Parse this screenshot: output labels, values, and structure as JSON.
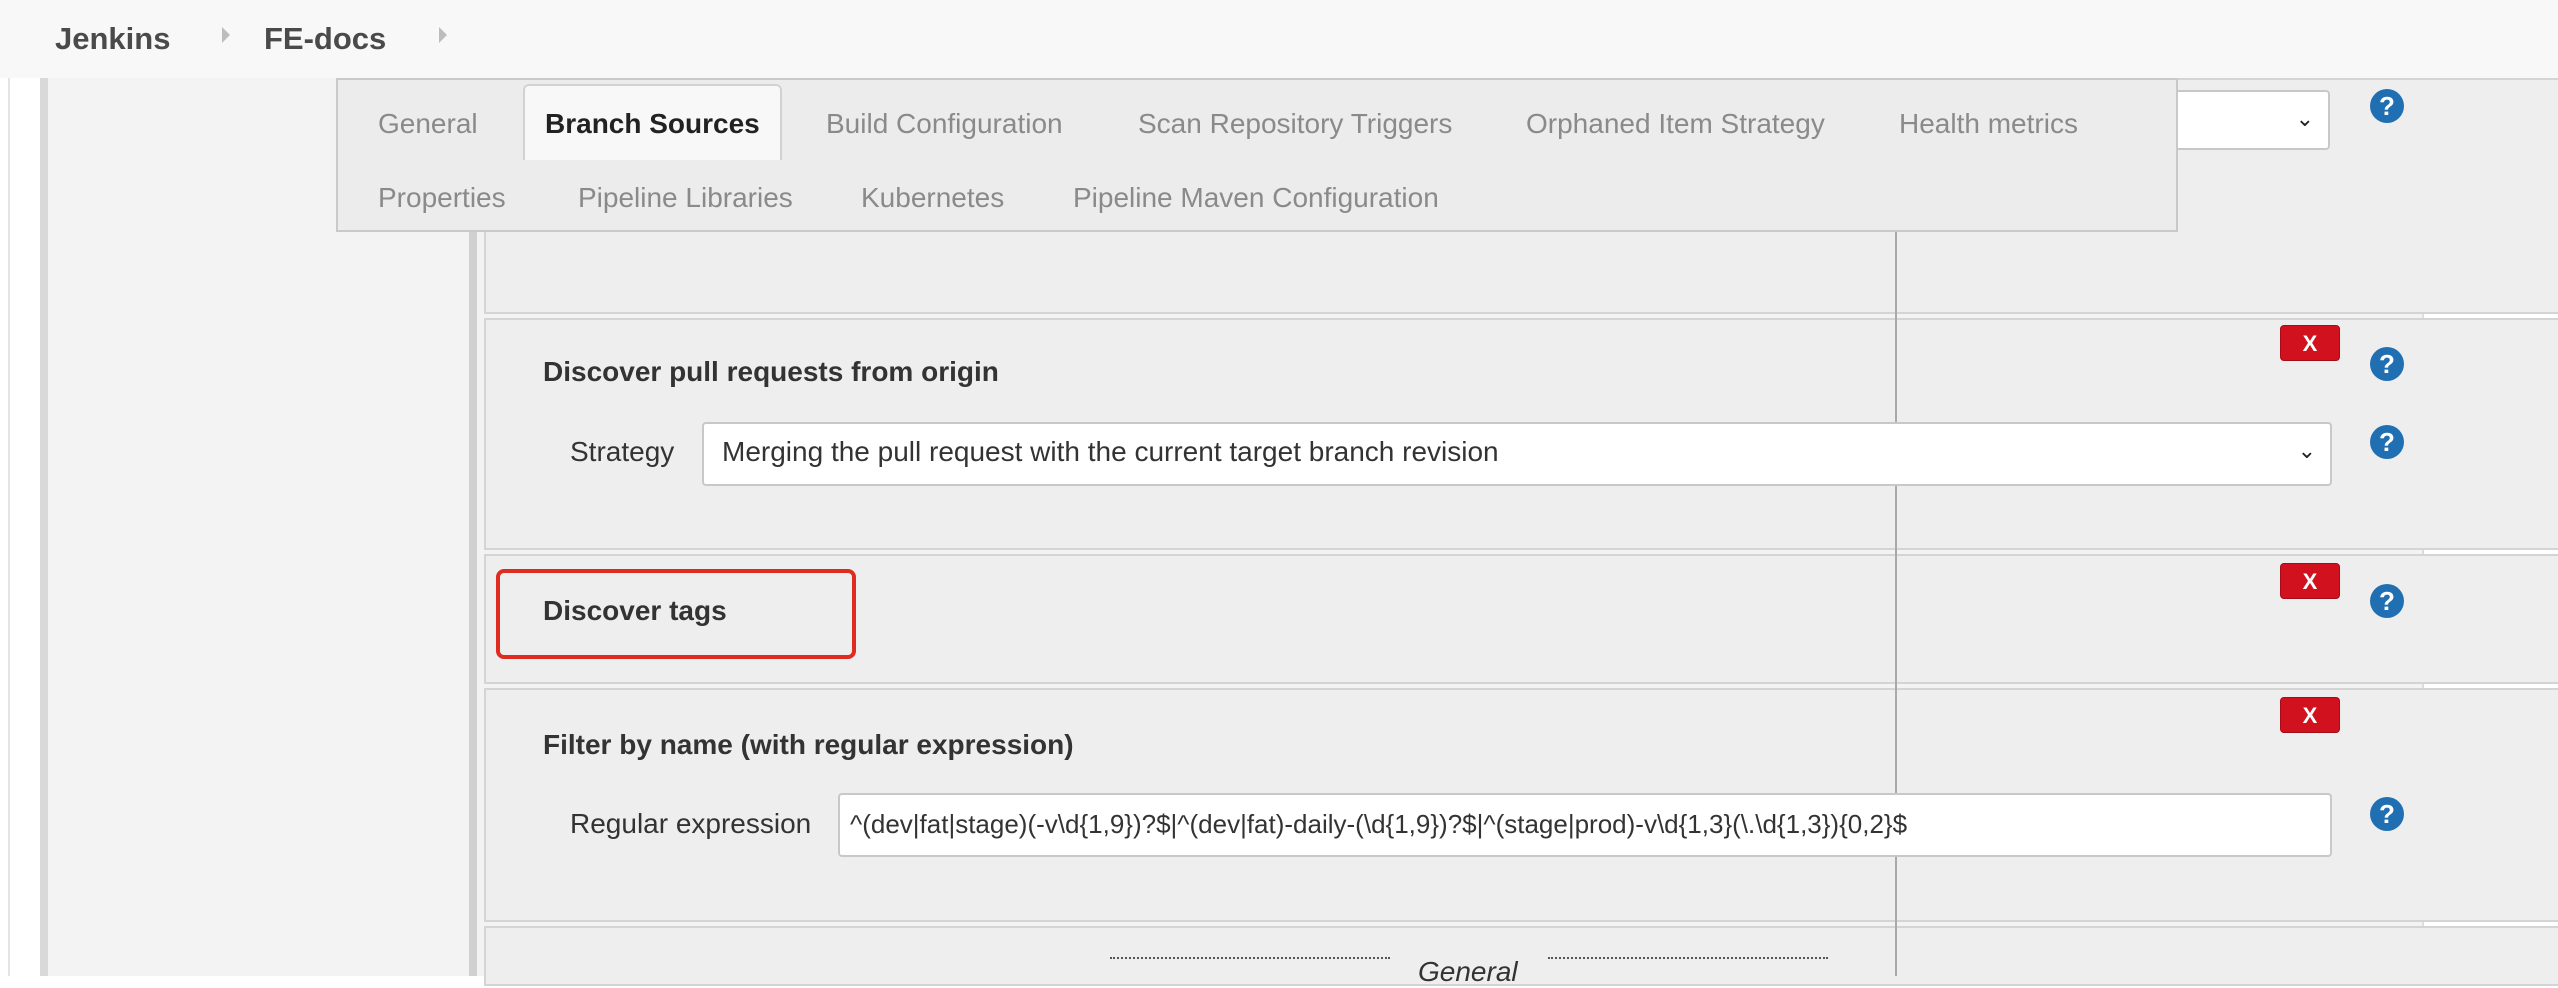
{
  "breadcrumb": {
    "items": [
      "Jenkins",
      "FE-docs"
    ]
  },
  "tabs": {
    "items": [
      "General",
      "Branch Sources",
      "Build Configuration",
      "Scan Repository Triggers",
      "Orphaned Item Strategy",
      "Health metrics",
      "Properties",
      "Pipeline Libraries",
      "Kubernetes",
      "Pipeline Maven Configuration"
    ],
    "active": "Branch Sources"
  },
  "sections": {
    "pull_requests": {
      "title": "Discover pull requests from origin",
      "strategy_label": "Strategy",
      "strategy_value": "Merging the pull request with the current target branch revision"
    },
    "tags": {
      "title": "Discover tags"
    },
    "filter": {
      "title": "Filter by name (with regular expression)",
      "regex_label": "Regular expression",
      "regex_value": "^(dev|fat|stage)(-v\\d{1,9})?$|^(dev|fat)-daily-(\\d{1,9})?$|^(stage|prod)-v\\d{1,3}(\\.\\d{1,3}){0,2}$"
    },
    "general_separator": "General"
  },
  "buttons": {
    "delete_label": "X",
    "help_label": "?"
  },
  "icons": {
    "caret": "chevron-down-icon",
    "breadcrumb_arrow": "chevron-right-icon"
  },
  "colors": {
    "delete": "#d2111f",
    "help": "#1f6fb2",
    "highlight": "#e02b20"
  }
}
